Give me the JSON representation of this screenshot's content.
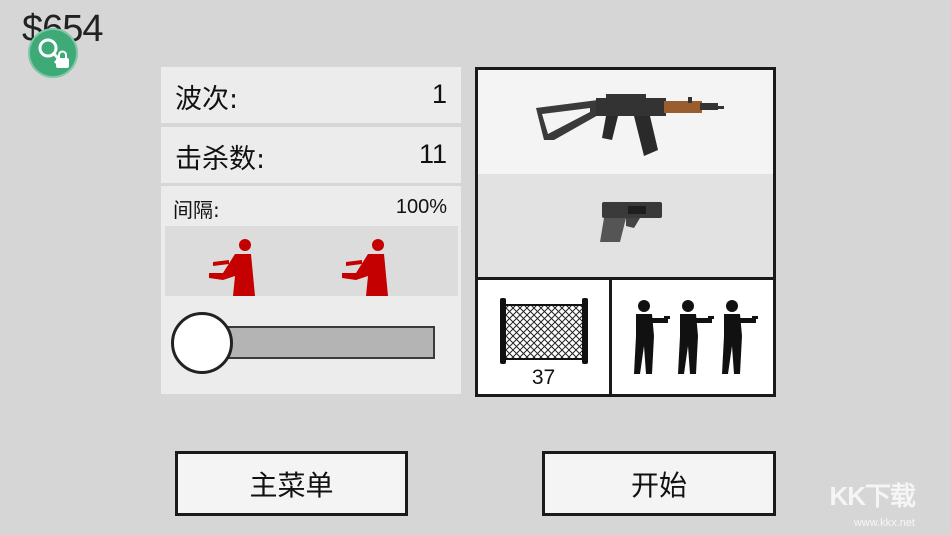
{
  "hud": {
    "money": "$654",
    "badge_icon": "key-lock-icon"
  },
  "stats": {
    "wave_label": "波次:",
    "wave_value": "1",
    "kills_label": "击杀数:",
    "kills_value": "11"
  },
  "interval": {
    "label": "间隔:",
    "value": "100%",
    "slider_fraction": 0.0
  },
  "loadout": {
    "primary_weapon_icon": "assault-rifle-icon",
    "secondary_weapon_icon": "pistol-icon",
    "fence_icon": "fence-icon",
    "fence_count": "37",
    "squad_icon": "soldier-squad-icon"
  },
  "buttons": {
    "main_menu": "主菜单",
    "start": "开始"
  },
  "watermark": {
    "text": "KK下载",
    "url": "www.kkx.net"
  },
  "colors": {
    "background": "#d6d6d6",
    "panel": "#ececec",
    "badge": "#3daa78",
    "enemy": "#c40000",
    "border": "#1a1a1a"
  }
}
